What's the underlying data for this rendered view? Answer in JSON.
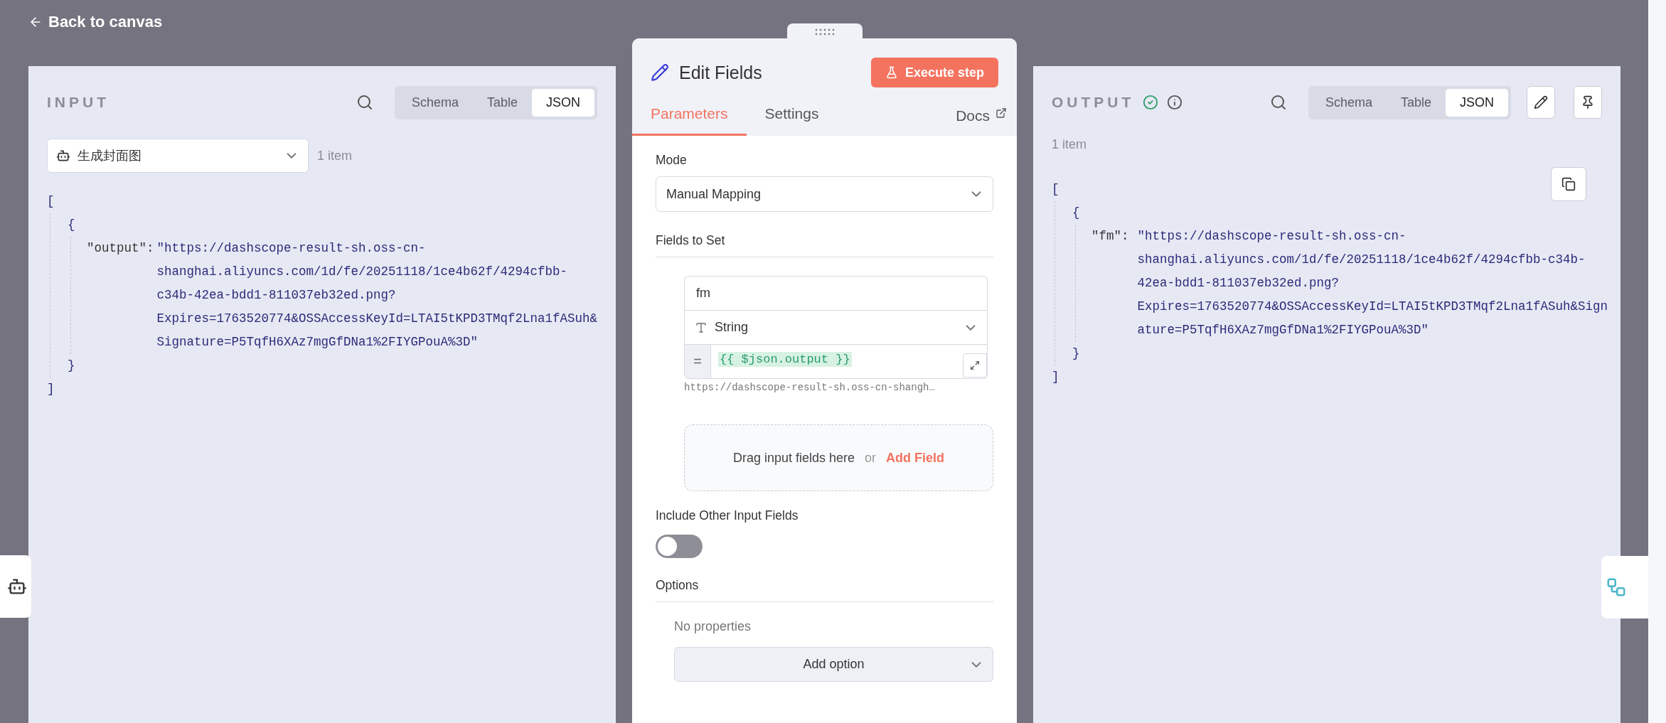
{
  "back_link": {
    "label": "Back to canvas"
  },
  "input_panel": {
    "title": "INPUT",
    "view_tabs": [
      {
        "label": "Schema",
        "selected": false
      },
      {
        "label": "Table",
        "selected": false
      },
      {
        "label": "JSON",
        "selected": true
      }
    ],
    "node_select": {
      "value": "生成封面图"
    },
    "item_count": "1 item",
    "json_view": {
      "open": "[",
      "object_open": "{",
      "key": "\"output\":",
      "value_lines": [
        "\"https://dashscope-result-sh.oss-cn-",
        "shanghai.aliyuncs.com/1d/fe/20251118/1ce4b62f/4294cfbb-",
        "c34b-42ea-bdd1-811037eb32ed.png?",
        "Expires=1763520774&OSSAccessKeyId=LTAI5tKPD3TMqf2Lna1fASuh&",
        "Signature=P5TqfH6XAz7mgGfDNa1%2FIYGPouA%3D\""
      ],
      "object_close": "}",
      "close": "]"
    }
  },
  "node_editor": {
    "title": "Edit Fields",
    "execute_button": "Execute step",
    "tabs": [
      {
        "label": "Parameters",
        "selected": true
      },
      {
        "label": "Settings",
        "selected": false
      }
    ],
    "docs_link": "Docs",
    "mode": {
      "label": "Mode",
      "value": "Manual Mapping"
    },
    "fields_to_set": {
      "label": "Fields to Set",
      "fields": [
        {
          "name": "fm",
          "type": "String",
          "expression_sign": "=",
          "value": "{{ $json.output }}",
          "preview": "https://dashscope-result-sh.oss-cn-shangh…"
        }
      ],
      "dropzone": {
        "text": "Drag input fields here",
        "or": "or",
        "link": "Add Field"
      }
    },
    "include_other": {
      "label": "Include Other Input Fields",
      "on": false
    },
    "options": {
      "label": "Options",
      "empty": "No properties",
      "add_button": "Add option"
    }
  },
  "output_panel": {
    "title": "OUTPUT",
    "view_tabs": [
      {
        "label": "Schema",
        "selected": false
      },
      {
        "label": "Table",
        "selected": false
      },
      {
        "label": "JSON",
        "selected": true
      }
    ],
    "item_count": "1 item",
    "json_view": {
      "open": "[",
      "object_open": "{",
      "key": "\"fm\":",
      "value_lines": [
        "\"https://dashscope-result-sh.oss-cn-",
        "shanghai.aliyuncs.com/1d/fe/20251118/1ce4b62f/4294cfbb-c34b-",
        "42ea-bdd1-811037eb32ed.png?",
        "Expires=1763520774&OSSAccessKeyId=LTAI5tKPD3TMqf2Lna1fASuh&Sign",
        "ature=P5TqfH6XAz7mgGfDNa1%2FIYGPouA%3D\""
      ],
      "object_close": "}",
      "close": "]"
    }
  }
}
